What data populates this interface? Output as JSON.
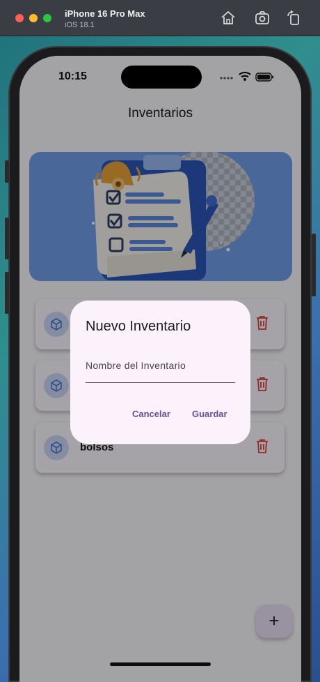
{
  "simulator": {
    "device_name": "iPhone 16 Pro Max",
    "os_version": "iOS 18.1",
    "icons": [
      "home-icon",
      "screenshot-icon",
      "rotate-icon"
    ]
  },
  "status_bar": {
    "time": "10:15"
  },
  "app": {
    "title": "Inventarios",
    "banner_icon": "clipboard-checklist-illustration",
    "inventories": [
      {
        "label": "",
        "icon": "cube-icon",
        "action_icon": "trash-icon"
      },
      {
        "label": "",
        "icon": "cube-icon",
        "action_icon": "trash-icon"
      },
      {
        "label": "bolsos",
        "icon": "cube-icon",
        "action_icon": "trash-icon"
      }
    ],
    "fab_label": "+"
  },
  "dialog": {
    "title": "Nuevo Inventario",
    "field_label": "Nombre del Inventario",
    "field_value": "",
    "cancel_label": "Cancelar",
    "save_label": "Guardar"
  },
  "colors": {
    "accent": "#6a4fa0",
    "delete": "#d9413a",
    "icon_blue": "#4a78d0",
    "banner": "#6f9ee8"
  }
}
